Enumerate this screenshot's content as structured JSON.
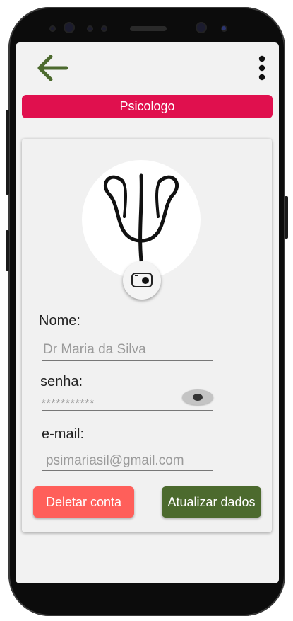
{
  "header": {
    "back_icon": "arrow-left-icon",
    "menu_icon": "more-vertical-icon",
    "accent_color": "#4c6a2e"
  },
  "title_bar": {
    "label": "Psicologo",
    "color": "#e0104e"
  },
  "profile": {
    "avatar_icon": "psi-symbol-icon",
    "camera_icon": "camera-icon"
  },
  "form": {
    "name_label": "Nome:",
    "name_value": "Dr Maria da Silva",
    "password_label": "senha:",
    "password_value": "***********",
    "password_toggle_icon": "eye-icon",
    "email_label": "e-mail:",
    "email_value": "psimariasil@gmail.com"
  },
  "actions": {
    "delete_label": "Deletar conta",
    "update_label": "Atualizar dados",
    "delete_color": "#ff5f5a",
    "update_color": "#4c6a2e"
  }
}
